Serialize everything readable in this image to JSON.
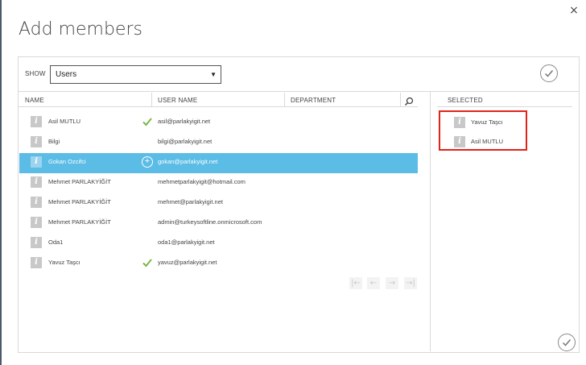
{
  "dialog": {
    "title": "Add members",
    "close_glyph": "×"
  },
  "show": {
    "label": "SHOW",
    "selected": "Users",
    "arrow": "▼"
  },
  "columns": {
    "name": "NAME",
    "user_name": "USER NAME",
    "department": "DEPARTMENT"
  },
  "users": [
    {
      "name": "Asil MUTLU",
      "email": "asil@parlakyigit.net",
      "marker": "check",
      "highlighted": false
    },
    {
      "name": "Bilgi",
      "email": "bilgi@parlakyigit.net",
      "marker": "",
      "highlighted": false
    },
    {
      "name": "Gokan Ozcifci",
      "email": "gokan@parlakyigit.net",
      "marker": "plus",
      "highlighted": true
    },
    {
      "name": "Mehmet PARLAKYİĞİT",
      "email": "mehmetparlakyigit@hotmail.com",
      "marker": "",
      "highlighted": false
    },
    {
      "name": "Mehmet PARLAKYİĞİT",
      "email": "mehmet@parlakyigit.net",
      "marker": "",
      "highlighted": false
    },
    {
      "name": "Mehmet PARLAKYİĞİT",
      "email": "admin@turkeysoftline.onmicrosoft.com",
      "marker": "",
      "highlighted": false
    },
    {
      "name": "Oda1",
      "email": "oda1@parlakyigit.net",
      "marker": "",
      "highlighted": false
    },
    {
      "name": "Yavuz Taşcı",
      "email": "yavuz@parlakyigit.net",
      "marker": "check",
      "highlighted": false
    }
  ],
  "user_icon_glyph": "i",
  "pager": {
    "first": "|←",
    "prev": "←",
    "next": "→",
    "last": "→|"
  },
  "selected": {
    "heading": "SELECTED",
    "items": [
      "Yavuz Taşcı",
      "Asil MUTLU"
    ]
  },
  "colors": {
    "highlight": "#5bbce6",
    "check_green": "#7ab648",
    "selection_border": "#e2231a"
  },
  "icons": [
    "close-icon",
    "chevron-down-icon",
    "checkmark-icon",
    "search-icon",
    "user-icon",
    "plus-icon",
    "first-page-icon",
    "prev-page-icon",
    "next-page-icon",
    "last-page-icon"
  ]
}
